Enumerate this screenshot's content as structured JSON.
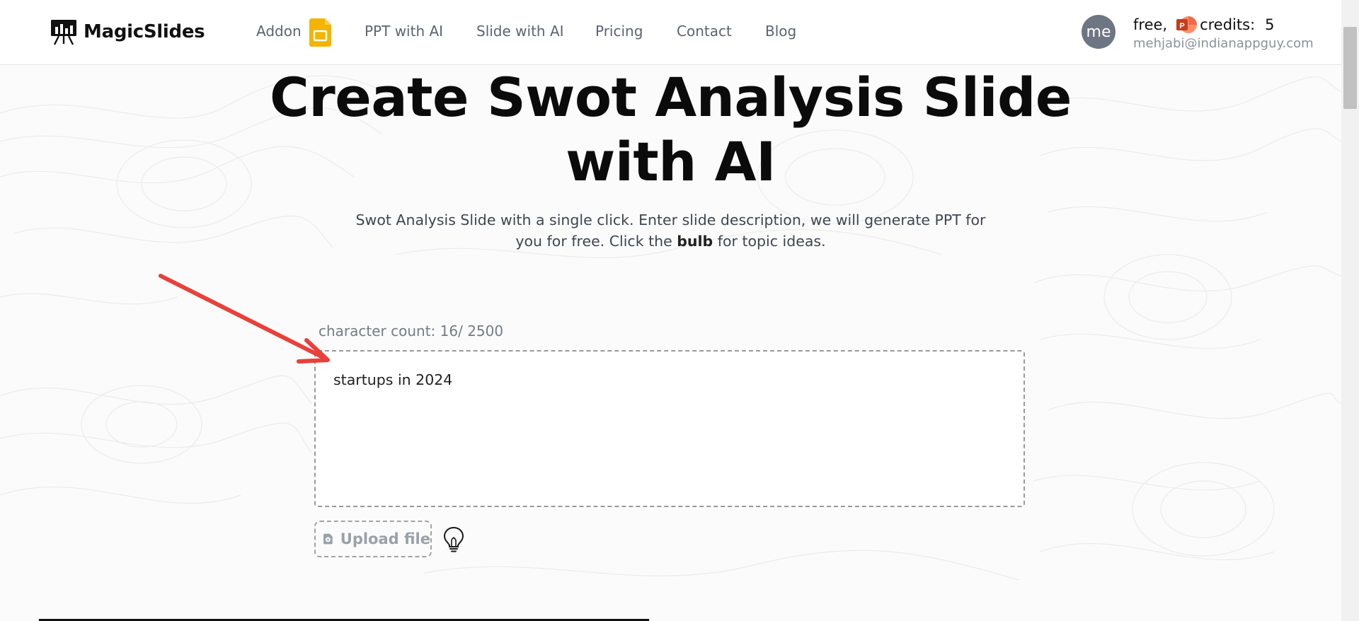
{
  "header": {
    "logo_text": "MagicSlides",
    "nav": {
      "addon": "Addon",
      "ppt_with_ai": "PPT with AI",
      "slide_with_ai": "Slide with AI",
      "pricing": "Pricing",
      "contact": "Contact",
      "blog": "Blog"
    },
    "account": {
      "avatar_initials": "me",
      "plan": "free",
      "plan_separator": ",",
      "credits_label": "credits:",
      "credits_value": "5",
      "email": "mehjabi@indianappguy.com"
    },
    "icons": {
      "logo": "presentation-board-icon",
      "addon": "google-slides-icon",
      "plan": "powerpoint-icon"
    }
  },
  "hero": {
    "title_line1": "Create Swot Analysis Slide",
    "title_line2": "with AI",
    "subtitle_line1": "Swot Analysis Slide with a single click. Enter slide description, we will generate PPT for",
    "subtitle_line2_before": "you for free. Click the ",
    "subtitle_bold": "bulb",
    "subtitle_line2_after": " for topic ideas."
  },
  "prompt": {
    "char_count_label": "character count: 16/ 2500",
    "value": "startups in 2024"
  },
  "actions": {
    "upload_label": "Upload file",
    "upload_icon": "upload-file-icon",
    "ideas_icon": "lightbulb-icon"
  },
  "annotation": {
    "arrow_color": "#e8403a"
  },
  "colors": {
    "addon_icon": "#f4b400",
    "avatar_bg": "#6e7684",
    "ppt_icon": "#d24726"
  }
}
